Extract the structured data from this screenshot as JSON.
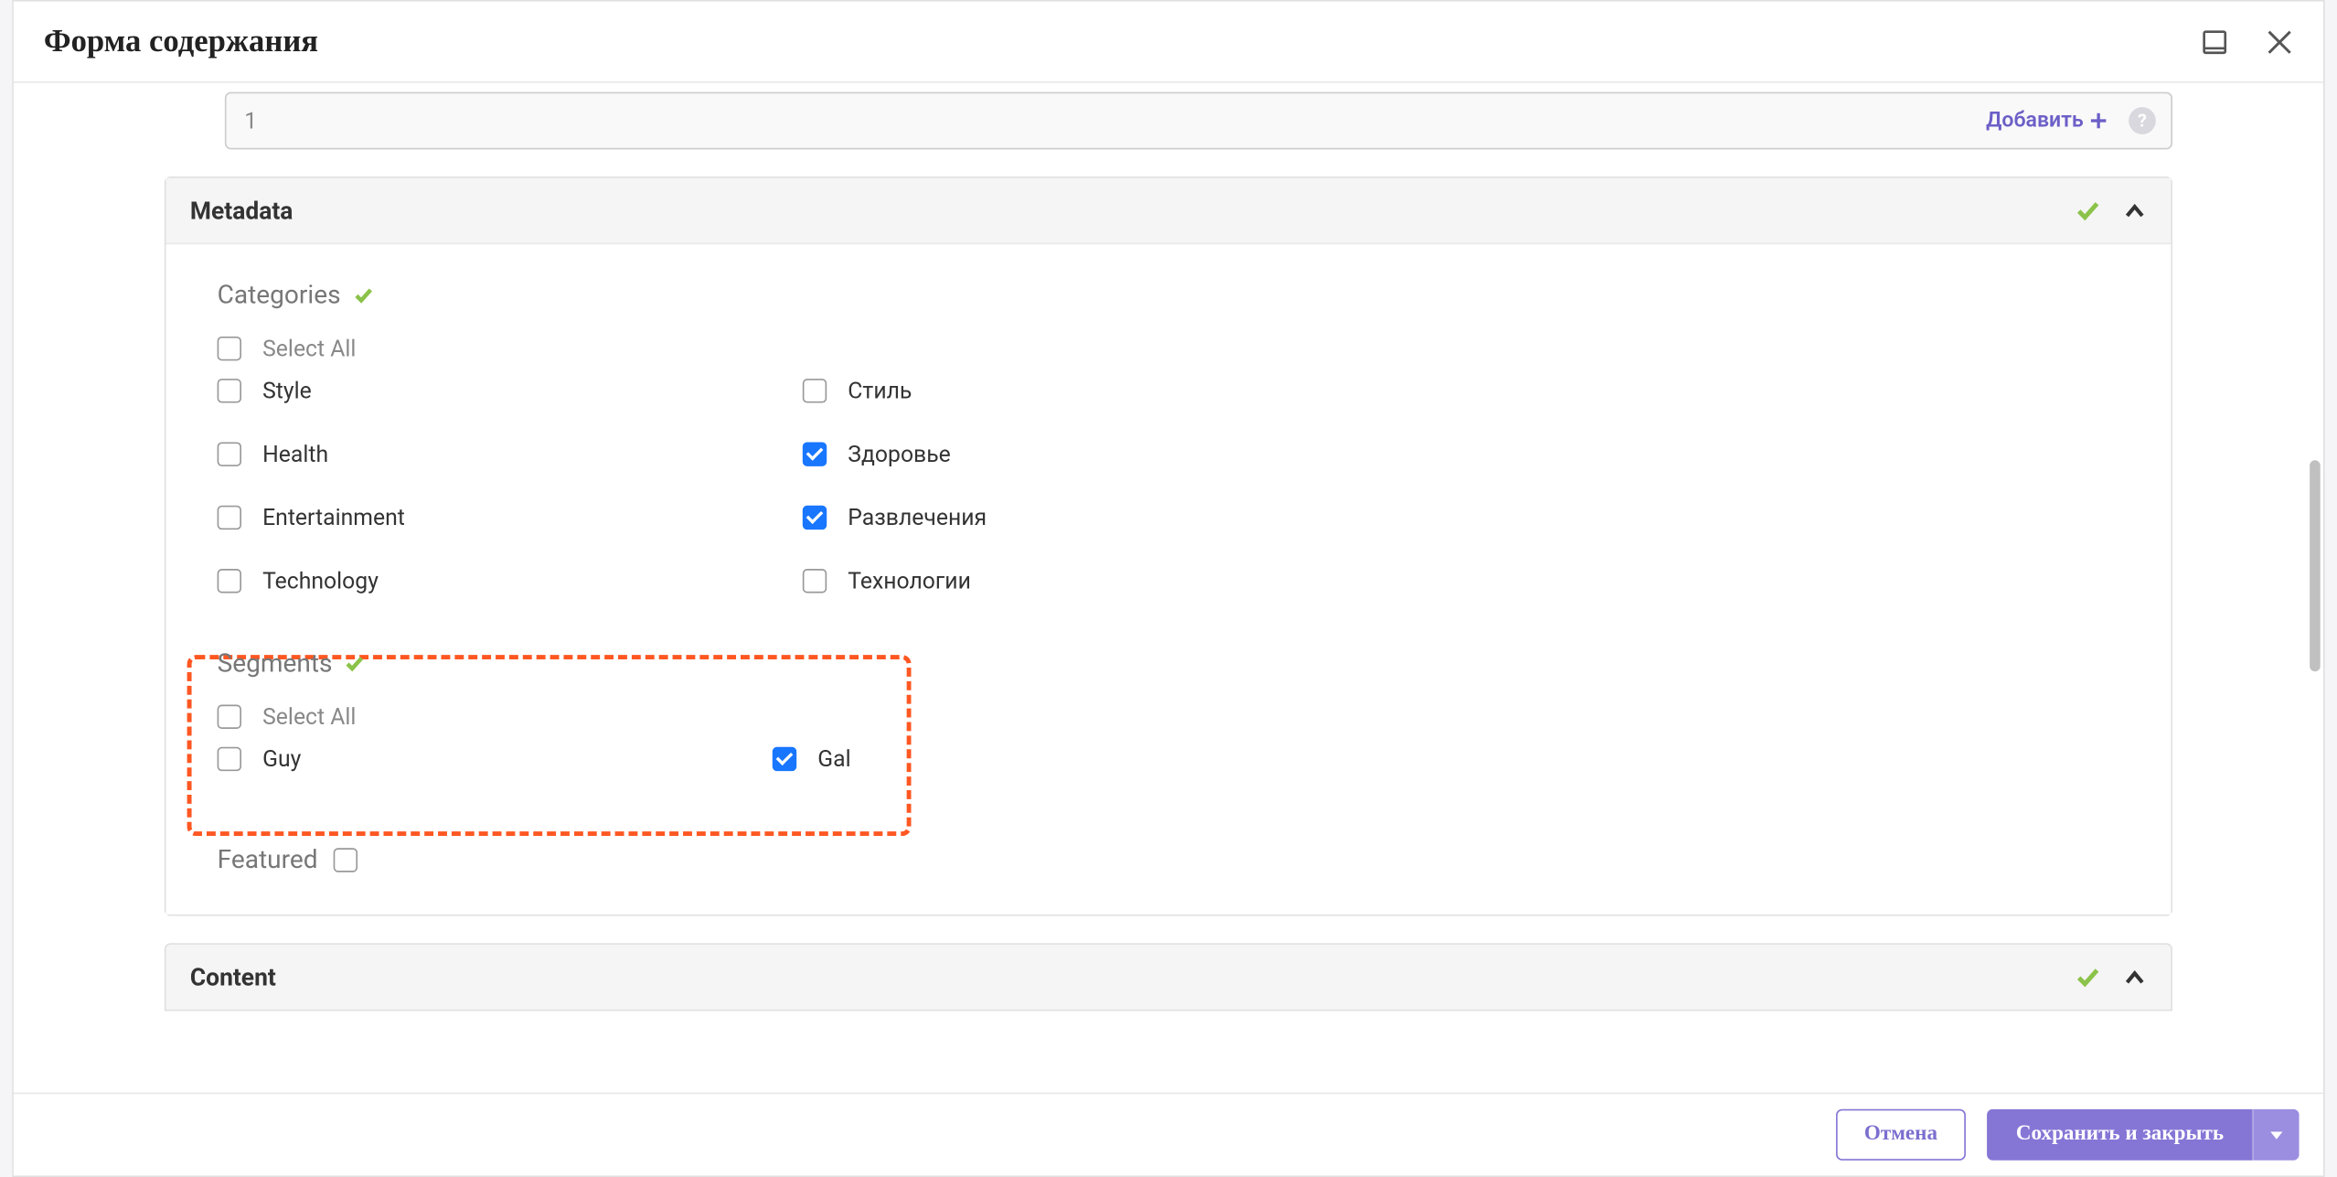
{
  "modal": {
    "title": "Форма содержания"
  },
  "number_field": {
    "value": "1",
    "add_label": "Добавить"
  },
  "metadata": {
    "title": "Metadata",
    "categories_label": "Categories",
    "select_all": "Select All",
    "cats": [
      {
        "en": "Style",
        "ru": "Стиль",
        "en_checked": false,
        "ru_checked": false
      },
      {
        "en": "Health",
        "ru": "Здоровье",
        "en_checked": false,
        "ru_checked": true
      },
      {
        "en": "Entertainment",
        "ru": "Развлечения",
        "en_checked": false,
        "ru_checked": true
      },
      {
        "en": "Technology",
        "ru": "Технологии",
        "en_checked": false,
        "ru_checked": false
      }
    ],
    "segments_label": "Segments",
    "segments_select_all": "Select All",
    "seg": [
      {
        "label": "Guy",
        "checked": false
      },
      {
        "label": "Gal",
        "checked": true
      }
    ],
    "featured_label": "Featured"
  },
  "content": {
    "title": "Content"
  },
  "footer": {
    "cancel": "Отмена",
    "save": "Сохранить и закрыть"
  }
}
